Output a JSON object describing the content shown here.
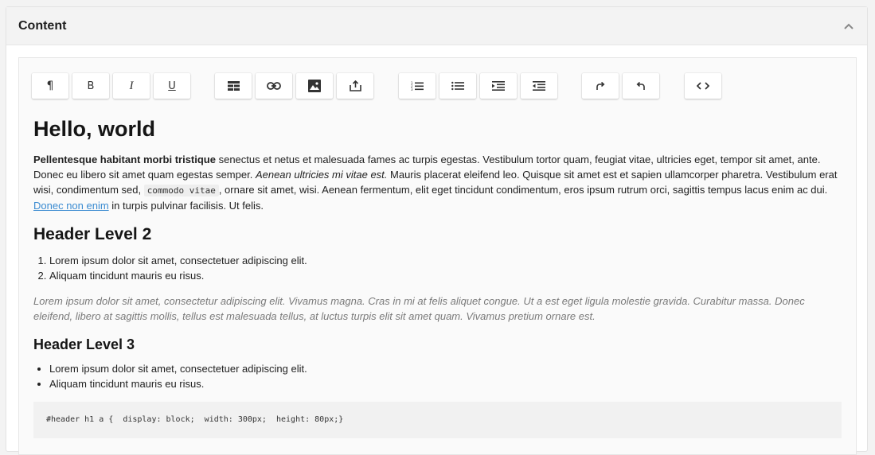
{
  "panel": {
    "title": "Content",
    "collapse_icon": "chevron-up-icon"
  },
  "toolbar": {
    "groups": [
      [
        {
          "name": "paragraph",
          "icon": "paragraph-icon",
          "glyph": "¶"
        },
        {
          "name": "bold",
          "icon": "bold-icon",
          "glyph": "B"
        },
        {
          "name": "italic",
          "icon": "italic-icon",
          "glyph": "I"
        },
        {
          "name": "underline",
          "icon": "underline-icon",
          "glyph": "U"
        }
      ],
      [
        {
          "name": "table",
          "icon": "table-icon"
        },
        {
          "name": "link",
          "icon": "link-icon"
        },
        {
          "name": "image",
          "icon": "image-icon"
        },
        {
          "name": "upload",
          "icon": "upload-icon"
        }
      ],
      [
        {
          "name": "ordered-list",
          "icon": "ordered-list-icon"
        },
        {
          "name": "bullet-list",
          "icon": "bullet-list-icon"
        },
        {
          "name": "indent",
          "icon": "indent-icon"
        },
        {
          "name": "outdent",
          "icon": "outdent-icon"
        }
      ],
      [
        {
          "name": "redo",
          "icon": "redo-icon"
        },
        {
          "name": "undo",
          "icon": "undo-icon"
        }
      ],
      [
        {
          "name": "source-code",
          "icon": "code-icon"
        }
      ]
    ]
  },
  "document": {
    "h1": "Hello, world",
    "p1": {
      "bold": "Pellentesque habitant morbi tristique",
      "text1": " senectus et netus et malesuada fames ac turpis egestas. Vestibulum tortor quam, feugiat vitae, ultricies eget, tempor sit amet, ante. Donec eu libero sit amet quam egestas semper. ",
      "italic": "Aenean ultricies mi vitae est.",
      "text2": " Mauris placerat eleifend leo. Quisque sit amet est et sapien ullamcorper pharetra. Vestibulum erat wisi, condimentum sed, ",
      "code": "commodo vitae",
      "text3": ", ornare sit amet, wisi. Aenean fermentum, elit eget tincidunt condimentum, eros ipsum rutrum orci, sagittis tempus lacus enim ac dui. ",
      "link": "Donec non enim",
      "text4": " in turpis pulvinar facilisis. Ut felis."
    },
    "h2": "Header Level 2",
    "ordered_list": [
      "Lorem ipsum dolor sit amet, consectetuer adipiscing elit.",
      "Aliquam tincidunt mauris eu risus."
    ],
    "blockquote": "Lorem ipsum dolor sit amet, consectetur adipiscing elit. Vivamus magna. Cras in mi at felis aliquet congue. Ut a est eget ligula molestie gravida. Curabitur massa. Donec eleifend, libero at sagittis mollis, tellus est malesuada tellus, at luctus turpis elit sit amet quam. Vivamus pretium ornare est.",
    "h3": "Header Level 3",
    "bullet_list": [
      "Lorem ipsum dolor sit amet, consectetuer adipiscing elit.",
      "Aliquam tincidunt mauris eu risus."
    ],
    "code_block": "#header h1 a {  display: block;  width: 300px;  height: 80px;}"
  }
}
